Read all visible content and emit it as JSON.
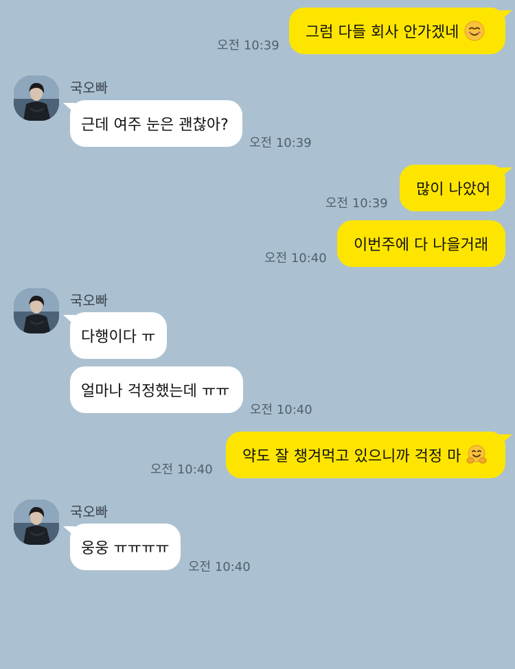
{
  "contact": {
    "name": "국오빠",
    "avatar_icon": "profile-photo"
  },
  "colors": {
    "background": "#abc1d1",
    "outgoing_bubble": "#fee500",
    "incoming_bubble": "#ffffff",
    "timestamp": "#4f5f6d"
  },
  "messages": [
    {
      "side": "out",
      "text": "그럼 다들 회사 안가겠네",
      "emoji": "smiling-face-icon",
      "time": "오전 10:39"
    },
    {
      "side": "in",
      "sender": "국오빠",
      "text": "근데 여주 눈은 괜찮아?",
      "time": "오전 10:39"
    },
    {
      "side": "out",
      "text": "많이 나았어",
      "time": "오전 10:39"
    },
    {
      "side": "out",
      "text": "이번주에 다 나을거래",
      "time": "오전 10:40"
    },
    {
      "side": "in",
      "sender": "국오빠",
      "text": "다행이다 ㅠ"
    },
    {
      "side": "in",
      "text": "얼마나 걱정했는데 ㅠㅠ",
      "time": "오전 10:40"
    },
    {
      "side": "out",
      "text": "약도 잘 챙겨먹고 있으니까 걱정 마",
      "emoji": "hugging-face-icon",
      "time": "오전 10:40"
    },
    {
      "side": "in",
      "sender": "국오빠",
      "text": "웅웅 ㅠㅠㅠㅠ",
      "time": "오전 10:40"
    }
  ]
}
